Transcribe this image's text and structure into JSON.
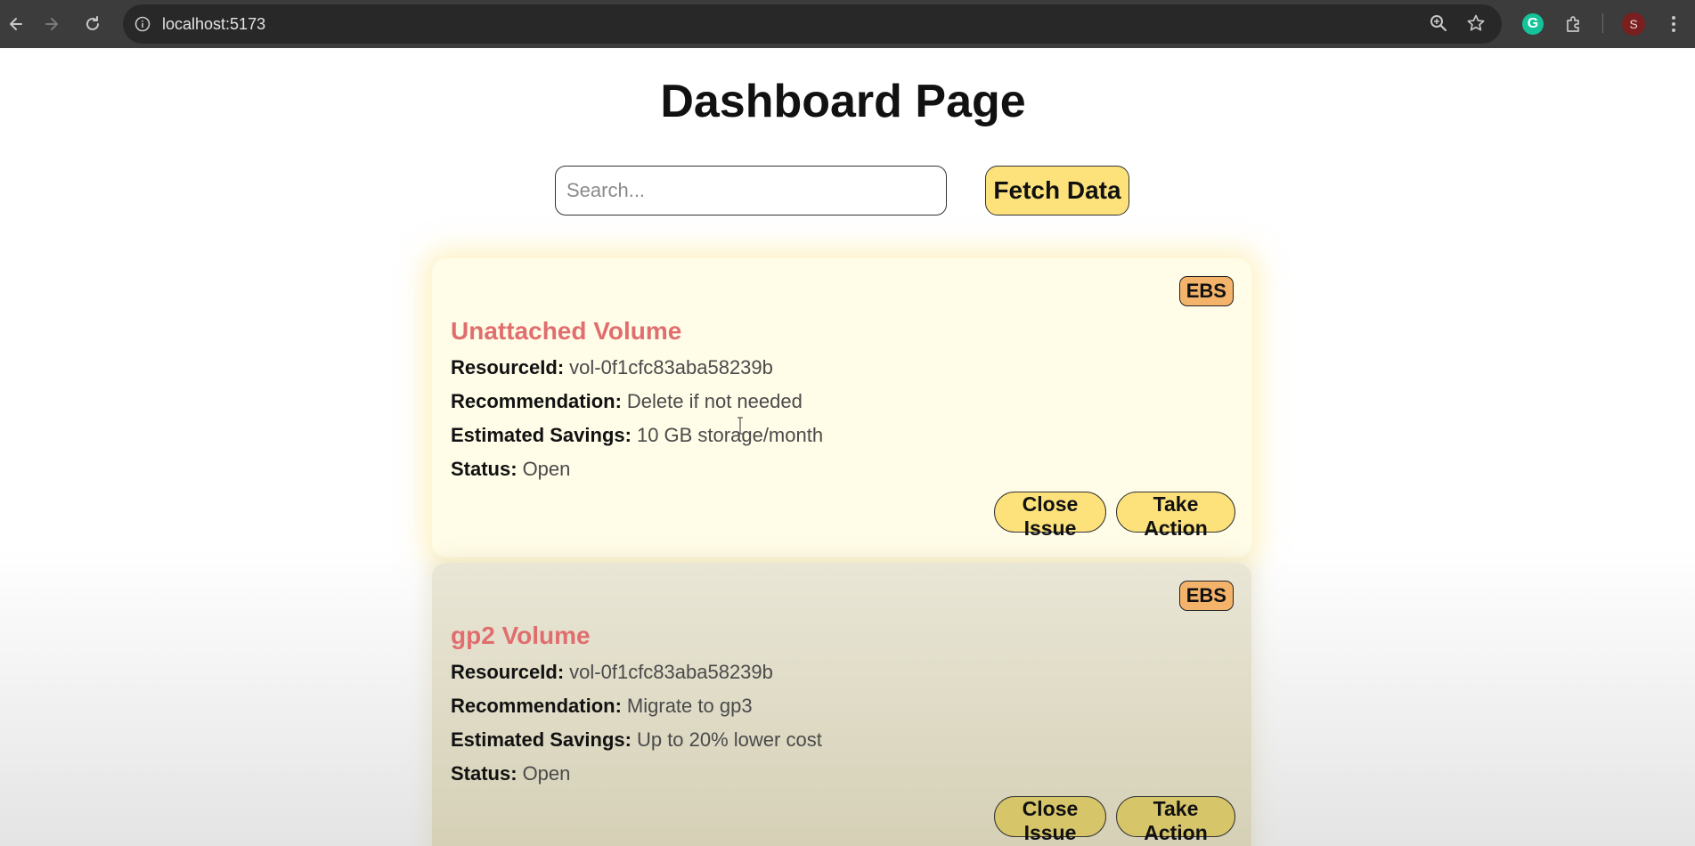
{
  "browser": {
    "url": "localhost:5173",
    "profile_initial": "S",
    "extension_initial": "G",
    "icons": [
      "back-icon",
      "forward-icon",
      "reload-icon",
      "site-info-icon",
      "zoom-icon",
      "bookmark-star-icon",
      "grammarly-icon",
      "extensions-icon",
      "profile-avatar",
      "menu-kebab-icon"
    ]
  },
  "page": {
    "title": "Dashboard Page",
    "search": {
      "placeholder": "Search...",
      "value": ""
    },
    "fetch_label": "Fetch Data"
  },
  "cards": [
    {
      "badge": "EBS",
      "title": "Unattached Volume",
      "fields": [
        {
          "label": "ResourceId:",
          "value": "vol-0f1cfc83aba58239b"
        },
        {
          "label": "Recommendation:",
          "value": "Delete if not needed"
        },
        {
          "label": "Estimated Savings:",
          "value": "10 GB storage/month"
        },
        {
          "label": "Status:",
          "value": "Open"
        }
      ],
      "close_label": "Close Issue",
      "action_label": "Take Action"
    },
    {
      "badge": "EBS",
      "title": "gp2 Volume",
      "fields": [
        {
          "label": "ResourceId:",
          "value": "vol-0f1cfc83aba58239b"
        },
        {
          "label": "Recommendation:",
          "value": "Migrate to gp3"
        },
        {
          "label": "Estimated Savings:",
          "value": "Up to 20% lower cost"
        },
        {
          "label": "Status:",
          "value": "Open"
        }
      ],
      "close_label": "Close Issue",
      "action_label": "Take Action"
    }
  ],
  "colors": {
    "button_yellow": "#fde27c",
    "badge_orange": "#f4b36a",
    "title_red": "#e06e6e",
    "chrome_dark": "#3c3c3c"
  }
}
